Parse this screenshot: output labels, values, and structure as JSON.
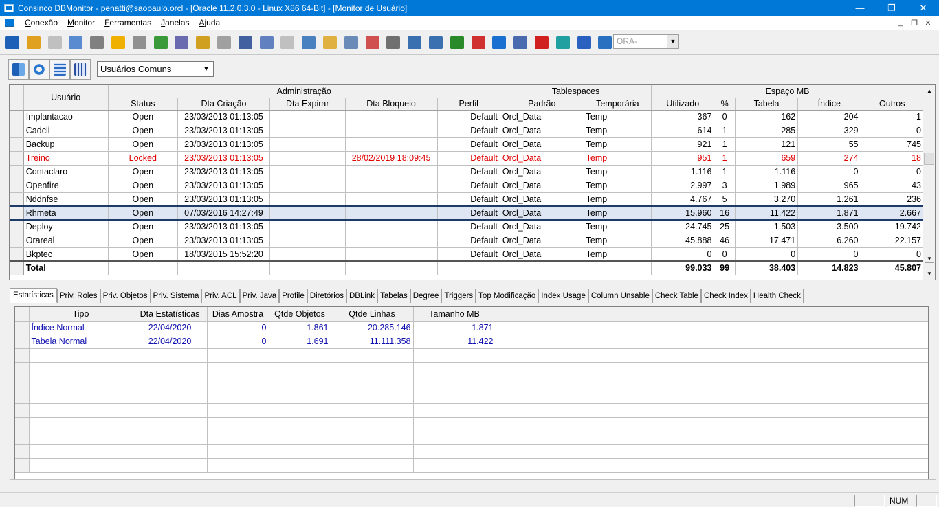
{
  "window": {
    "title": "Consinco DBMonitor - penatti@saopaulo.orcl - [Oracle 11.2.0.3.0 - Linux X86 64-Bit] - [Monitor de Usuário]",
    "controls": [
      "—",
      "❐",
      "✕"
    ]
  },
  "menu": {
    "items": [
      "Conexão",
      "Monitor",
      "Ferramentas",
      "Janelas",
      "Ajuda"
    ],
    "mdi_controls": [
      "_",
      "❐",
      "✕"
    ]
  },
  "toolbar": {
    "icons": [
      "disconnect-icon",
      "key-icon",
      "search-key-icon",
      "user-icon",
      "lock-icon",
      "star-icon",
      "glasses-icon",
      "tablespace-icon",
      "sql-icon",
      "clock-icon",
      "database-icon",
      "users-icon",
      "pages-icon",
      "document-icon",
      "report-icon",
      "note-icon",
      "calendar-grid-icon",
      "calendar-icon",
      "list-icon",
      "export-icon",
      "people-icon",
      "chart-icon",
      "alarm-icon",
      "info-icon",
      "calculator-icon",
      "oracle-icon",
      "gear-icon",
      "back-icon",
      "book-icon"
    ],
    "ora_combo": "ORA-"
  },
  "toolbar2": {
    "icons": [
      "exit-icon",
      "refresh-icon",
      "grid-icon",
      "columns-icon"
    ],
    "user_filter": "Usuários Comuns"
  },
  "users_grid": {
    "group_headers": {
      "user": "Usuário",
      "admin": "Administração",
      "ts": "Tablespaces",
      "space": "Espaço MB"
    },
    "columns": [
      "Status",
      "Dta Criação",
      "Dta Expirar",
      "Dta Bloqueio",
      "Perfil",
      "Padrão",
      "Temporária",
      "Utilizado",
      "%",
      "Tabela",
      "Índice",
      "Outros"
    ],
    "rows": [
      {
        "user": "Implantacao",
        "status": "Open",
        "created": "23/03/2013 01:13:05",
        "expire": "",
        "locked_at": "",
        "profile": "Default",
        "default_ts": "Orcl_Data",
        "temp_ts": "Temp",
        "used": "367",
        "pct": "0",
        "table": "162",
        "index": "204",
        "other": "1"
      },
      {
        "user": "Cadcli",
        "status": "Open",
        "created": "23/03/2013 01:13:05",
        "expire": "",
        "locked_at": "",
        "profile": "Default",
        "default_ts": "Orcl_Data",
        "temp_ts": "Temp",
        "used": "614",
        "pct": "1",
        "table": "285",
        "index": "329",
        "other": "0"
      },
      {
        "user": "Backup",
        "status": "Open",
        "created": "23/03/2013 01:13:05",
        "expire": "",
        "locked_at": "",
        "profile": "Default",
        "default_ts": "Orcl_Data",
        "temp_ts": "Temp",
        "used": "921",
        "pct": "1",
        "table": "121",
        "index": "55",
        "other": "745"
      },
      {
        "user": "Treino",
        "status": "Locked",
        "created": "23/03/2013 01:13:05",
        "expire": "",
        "locked_at": "28/02/2019 18:09:45",
        "profile": "Default",
        "default_ts": "Orcl_Data",
        "temp_ts": "Temp",
        "used": "951",
        "pct": "1",
        "table": "659",
        "index": "274",
        "other": "18"
      },
      {
        "user": "Contaclaro",
        "status": "Open",
        "created": "23/03/2013 01:13:05",
        "expire": "",
        "locked_at": "",
        "profile": "Default",
        "default_ts": "Orcl_Data",
        "temp_ts": "Temp",
        "used": "1.116",
        "pct": "1",
        "table": "1.116",
        "index": "0",
        "other": "0"
      },
      {
        "user": "Openfire",
        "status": "Open",
        "created": "23/03/2013 01:13:05",
        "expire": "",
        "locked_at": "",
        "profile": "Default",
        "default_ts": "Orcl_Data",
        "temp_ts": "Temp",
        "used": "2.997",
        "pct": "3",
        "table": "1.989",
        "index": "965",
        "other": "43"
      },
      {
        "user": "Nddnfse",
        "status": "Open",
        "created": "23/03/2013 01:13:05",
        "expire": "",
        "locked_at": "",
        "profile": "Default",
        "default_ts": "Orcl_Data",
        "temp_ts": "Temp",
        "used": "4.767",
        "pct": "5",
        "table": "3.270",
        "index": "1.261",
        "other": "236"
      },
      {
        "user": "Rhmeta",
        "status": "Open",
        "created": "07/03/2016 14:27:49",
        "expire": "",
        "locked_at": "",
        "profile": "Default",
        "default_ts": "Orcl_Data",
        "temp_ts": "Temp",
        "used": "15.960",
        "pct": "16",
        "table": "11.422",
        "index": "1.871",
        "other": "2.667"
      },
      {
        "user": "Deploy",
        "status": "Open",
        "created": "23/03/2013 01:13:05",
        "expire": "",
        "locked_at": "",
        "profile": "Default",
        "default_ts": "Orcl_Data",
        "temp_ts": "Temp",
        "used": "24.745",
        "pct": "25",
        "table": "1.503",
        "index": "3.500",
        "other": "19.742"
      },
      {
        "user": "Orareal",
        "status": "Open",
        "created": "23/03/2013 01:13:05",
        "expire": "",
        "locked_at": "",
        "profile": "Default",
        "default_ts": "Orcl_Data",
        "temp_ts": "Temp",
        "used": "45.888",
        "pct": "46",
        "table": "17.471",
        "index": "6.260",
        "other": "22.157"
      },
      {
        "user": "Bkptec",
        "status": "Open",
        "created": "18/03/2015 15:52:20",
        "expire": "",
        "locked_at": "",
        "profile": "Default",
        "default_ts": "Orcl_Data",
        "temp_ts": "Temp",
        "used": "0",
        "pct": "0",
        "table": "0",
        "index": "0",
        "other": "0"
      }
    ],
    "total": {
      "label": "Total",
      "used": "99.033",
      "pct": "99",
      "table": "38.403",
      "index": "14.823",
      "other": "45.807"
    },
    "locked_color": "#e00000",
    "selected_row": "Rhmeta"
  },
  "tabs": [
    "Estatísticas",
    "Priv. Roles",
    "Priv. Objetos",
    "Priv. Sistema",
    "Priv. ACL",
    "Priv. Java",
    "Profile",
    "Diretórios",
    "DBLink",
    "Tabelas",
    "Degree",
    "Triggers",
    "Top Modificação",
    "Index Usage",
    "Column Unsable",
    "Check Table",
    "Check Index",
    "Health Check"
  ],
  "active_tab": "Estatísticas",
  "stats_grid": {
    "columns": [
      "Tipo",
      "Dta Estatísticas",
      "Dias Amostra",
      "Qtde Objetos",
      "Qtde Linhas",
      "Tamanho MB"
    ],
    "rows": [
      {
        "tipo": "Índice Normal",
        "date": "22/04/2020",
        "days": "0",
        "objects": "1.861",
        "lines": "20.285.146",
        "size": "1.871"
      },
      {
        "tipo": "Tabela Normal",
        "date": "22/04/2020",
        "days": "0",
        "objects": "1.691",
        "lines": "11.111.358",
        "size": "11.422"
      }
    ],
    "text_color": "#1010b0"
  },
  "statusbar": {
    "num": "NUM"
  }
}
